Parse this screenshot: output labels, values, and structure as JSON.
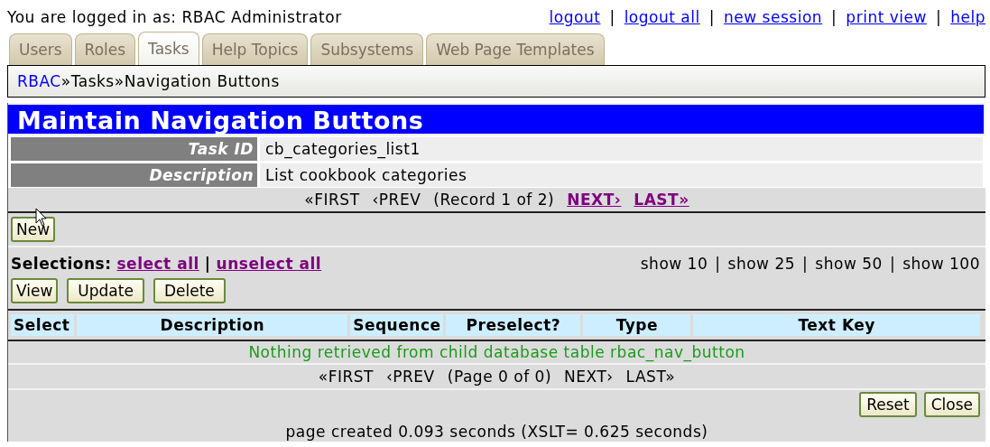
{
  "session": {
    "user_label": "You are logged in as: RBAC Administrator",
    "separator": "|",
    "links": [
      "logout",
      "logout all",
      "new session",
      "print view",
      "help"
    ]
  },
  "tabs": [
    {
      "label": "Users",
      "selected": false
    },
    {
      "label": "Roles",
      "selected": false
    },
    {
      "label": "Tasks",
      "selected": true
    },
    {
      "label": "Help Topics",
      "selected": false
    },
    {
      "label": "Subsystems",
      "selected": false
    },
    {
      "label": "Web Page Templates",
      "selected": false
    }
  ],
  "breadcrumb": {
    "separator": "»",
    "items": [
      {
        "label": "RBAC",
        "link": true
      },
      {
        "label": "Tasks",
        "link": false
      },
      {
        "label": "Navigation Buttons",
        "link": false
      }
    ]
  },
  "title": "Maintain Navigation Buttons",
  "fields": [
    {
      "label": "Task ID",
      "value": "cb_categories_list1"
    },
    {
      "label": "Description",
      "value": "List cookbook categories"
    }
  ],
  "record_nav": {
    "before": [
      {
        "label": "«FIRST",
        "enabled": false
      },
      {
        "label": "‹PREV",
        "enabled": false
      }
    ],
    "status": "(Record 1 of 2)",
    "after": [
      {
        "label": "NEXT›",
        "enabled": true
      },
      {
        "label": "LAST»",
        "enabled": true
      }
    ]
  },
  "new_button": "New",
  "selections": {
    "label": "Selections:",
    "separator": "|",
    "links": [
      "select all",
      "unselect all"
    ]
  },
  "page_sizes": {
    "separator": "|",
    "items": [
      "show 10",
      "show 25",
      "show 50",
      "show 100"
    ]
  },
  "action_buttons": [
    "View",
    "Update",
    "Delete"
  ],
  "table": {
    "columns": [
      "Select",
      "Description",
      "Sequence",
      "Preselect?",
      "Type",
      "Text Key"
    ],
    "empty_message": "Nothing retrieved from child database table rbac_nav_button"
  },
  "page_nav": {
    "before": [
      {
        "label": "«FIRST",
        "enabled": false
      },
      {
        "label": "‹PREV",
        "enabled": false
      }
    ],
    "status": "(Page 0 of 0)",
    "after": [
      {
        "label": "NEXT›",
        "enabled": false
      },
      {
        "label": "LAST»",
        "enabled": false
      }
    ]
  },
  "footer_buttons": [
    "Reset",
    "Close"
  ],
  "status": "page created 0.093 seconds (XSLT= 0.625 seconds)"
}
